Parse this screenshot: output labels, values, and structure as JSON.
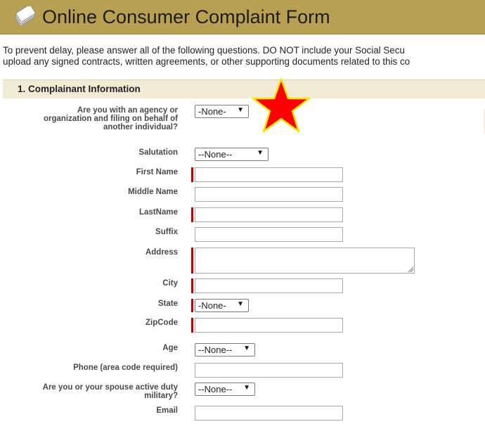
{
  "header": {
    "title": "Online Consumer Complaint Form",
    "logo_icon": "document-icon"
  },
  "intro": {
    "line1": "To prevent delay, please answer all of the following questions. DO NOT include your Social Secu",
    "line2": "upload any signed contracts, written agreements, or other supporting documents related to this co"
  },
  "section": {
    "title": "1. Complainant Information"
  },
  "fields": {
    "agency": {
      "label": [
        "Are you with an agency or",
        "organization and filing on behalf of",
        "another individual?"
      ],
      "value": "-None-"
    },
    "salutation": {
      "label": "Salutation",
      "value": "--None--"
    },
    "first_name": {
      "label": "First Name",
      "value": "",
      "required": true
    },
    "middle_name": {
      "label": "Middle Name",
      "value": ""
    },
    "last_name": {
      "label": "LastName",
      "value": "",
      "required": true
    },
    "suffix": {
      "label": "Suffix",
      "value": ""
    },
    "address": {
      "label": "Address",
      "value": "",
      "required": true
    },
    "city": {
      "label": "City",
      "value": "",
      "required": true
    },
    "state": {
      "label": "State",
      "value": "-None-",
      "required": true
    },
    "zipcode": {
      "label": "ZipCode",
      "value": "",
      "required": true
    },
    "age": {
      "label": "Age",
      "value": "--None--"
    },
    "phone": {
      "label": "Phone (area code required)",
      "value": ""
    },
    "military": {
      "label": [
        "Are you or your spouse active duty",
        "military?"
      ],
      "value": "--None--"
    },
    "email": {
      "label": "Email",
      "value": ""
    }
  },
  "colors": {
    "header": "#b8a052",
    "section": "#f1ead4",
    "required": "#c00000",
    "star": "#ff0000"
  }
}
